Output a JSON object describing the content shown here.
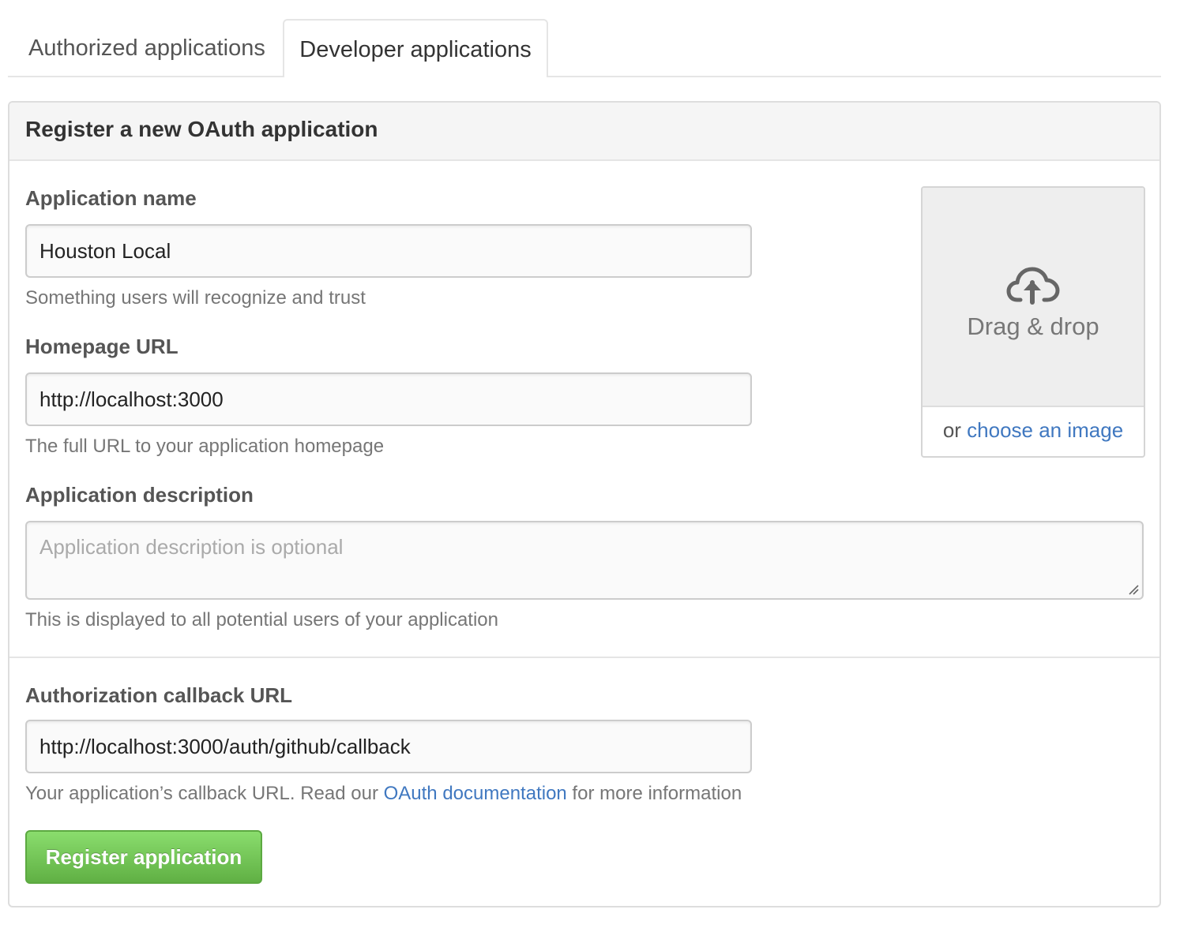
{
  "tabs": [
    {
      "label": "Authorized applications",
      "active": false
    },
    {
      "label": "Developer applications",
      "active": true
    }
  ],
  "panel": {
    "title": "Register a new OAuth application"
  },
  "form": {
    "app_name": {
      "label": "Application name",
      "value": "Houston Local",
      "hint": "Something users will recognize and trust"
    },
    "homepage_url": {
      "label": "Homepage URL",
      "value": "http://localhost:3000",
      "hint": "The full URL to your application homepage"
    },
    "description": {
      "label": "Application description",
      "placeholder": "Application description is optional",
      "hint": "This is displayed to all potential users of your application"
    },
    "callback_url": {
      "label": "Authorization callback URL",
      "value": "http://localhost:3000/auth/github/callback",
      "hint_prefix": "Your application’s callback URL. Read our ",
      "hint_link": "OAuth documentation",
      "hint_suffix": " for more information"
    },
    "submit_label": "Register application"
  },
  "image_upload": {
    "icon": "cloud-upload-icon",
    "drop_label": "Drag & drop",
    "choose_prefix": "or ",
    "choose_link": "choose an image"
  },
  "colors": {
    "link": "#4078c0",
    "button_green": "#60b044"
  }
}
